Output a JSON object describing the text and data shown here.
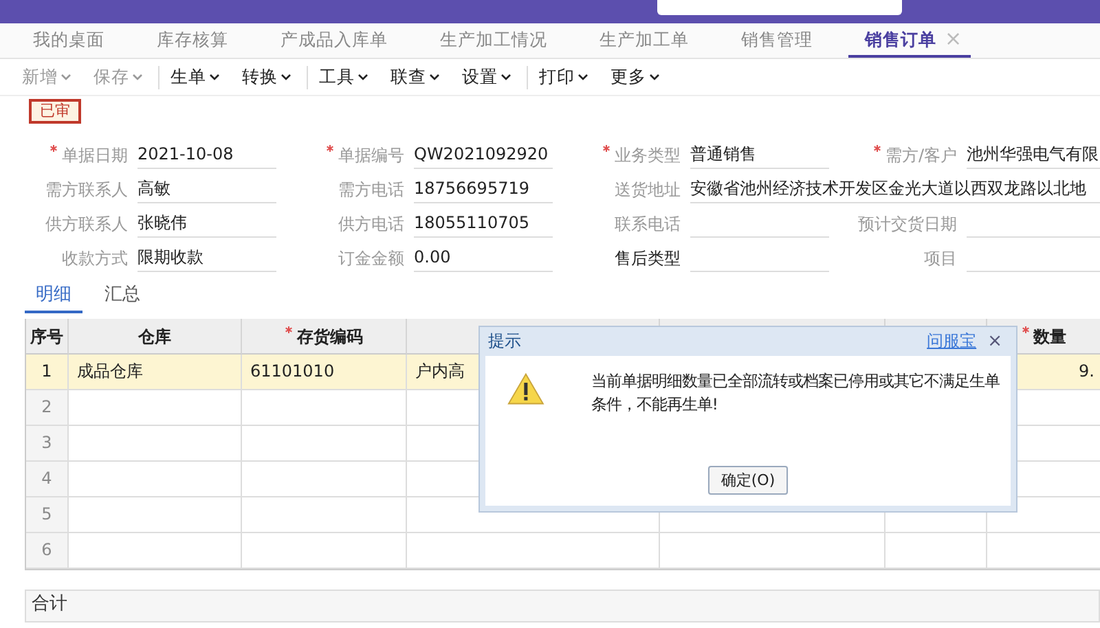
{
  "tabs": [
    {
      "label": "我的桌面",
      "selected": false
    },
    {
      "label": "库存核算",
      "selected": false
    },
    {
      "label": "产成品入库单",
      "selected": false
    },
    {
      "label": "生产加工情况",
      "selected": false
    },
    {
      "label": "生产加工单",
      "selected": false
    },
    {
      "label": "销售管理",
      "selected": false
    },
    {
      "label": "销售订单",
      "selected": true,
      "close": "×"
    }
  ],
  "toolbar": [
    {
      "label": "新增",
      "disabled": true,
      "divider_before": false
    },
    {
      "label": "保存",
      "disabled": true,
      "divider_before": false
    },
    {
      "label": "生单",
      "disabled": false,
      "divider_before": true
    },
    {
      "label": "转换",
      "disabled": false,
      "divider_before": false
    },
    {
      "label": "工具",
      "disabled": false,
      "divider_before": true
    },
    {
      "label": "联查",
      "disabled": false,
      "divider_before": false
    },
    {
      "label": "设置",
      "disabled": false,
      "divider_before": false
    },
    {
      "label": "打印",
      "disabled": false,
      "divider_before": true
    },
    {
      "label": "更多",
      "disabled": false,
      "divider_before": false
    }
  ],
  "status_stamp": "已审",
  "form": {
    "rows": [
      [
        {
          "label": "单据日期",
          "value": "2021-10-08",
          "required": true,
          "dark": false,
          "wide": false
        },
        {
          "label": "单据编号",
          "value": "QW2021092920",
          "required": true,
          "dark": false,
          "wide": false
        },
        {
          "label": "业务类型",
          "value": "普通销售",
          "required": true,
          "dark": false,
          "wide": false
        },
        {
          "label": "需方/客户",
          "value": "池州华强电气有限",
          "required": true,
          "dark": false,
          "wide": false
        }
      ],
      [
        {
          "label": "需方联系人",
          "value": "高敏",
          "required": false,
          "dark": false,
          "wide": false
        },
        {
          "label": "需方电话",
          "value": "18756695719",
          "required": false,
          "dark": false,
          "wide": false
        },
        {
          "label": "送货地址",
          "value": "安徽省池州经济技术开发区金光大道以西双龙路以北地",
          "required": false,
          "dark": false,
          "wide": true
        }
      ],
      [
        {
          "label": "供方联系人",
          "value": "张晓伟",
          "required": false,
          "dark": false,
          "wide": false
        },
        {
          "label": "供方电话",
          "value": "18055110705",
          "required": false,
          "dark": false,
          "wide": false
        },
        {
          "label": "联系电话",
          "required": false,
          "dark": false,
          "wide": false
        },
        {
          "label": "预计交货日期",
          "required": false,
          "dark": false,
          "wide": false
        }
      ],
      [
        {
          "label": "收款方式",
          "value": "限期收款",
          "required": false,
          "dark": false,
          "wide": false
        },
        {
          "label": "订金金额",
          "value": "0.00",
          "required": false,
          "dark": false,
          "wide": false
        },
        {
          "label": "售后类型",
          "required": false,
          "dark": true,
          "wide": false
        },
        {
          "label": "项目",
          "required": false,
          "dark": false,
          "wide": false
        }
      ]
    ]
  },
  "detail_tabs": [
    {
      "label": "明细",
      "selected": true
    },
    {
      "label": "汇总",
      "selected": false
    }
  ],
  "table": {
    "columns": {
      "column_1": {
        "label": "序号",
        "required": false
      },
      "column_2": {
        "label": "仓库",
        "required": false
      },
      "column_3": {
        "label": "存货编码",
        "required": true
      },
      "column_7": {
        "label": "数量",
        "required": true
      }
    },
    "rows": [
      {
        "selected": true,
        "cells": {
          "column_1": "1",
          "column_2": "成品仓库",
          "column_3": "61101010",
          "column_4": "户内高",
          "column_7": "9."
        }
      },
      {
        "selected": false,
        "cells": {
          "column_1": "2"
        }
      },
      {
        "selected": false,
        "cells": {
          "column_1": "3"
        }
      },
      {
        "selected": false,
        "cells": {
          "column_1": "4"
        }
      },
      {
        "selected": false,
        "cells": {
          "column_1": "5"
        }
      },
      {
        "selected": false,
        "cells": {
          "column_1": "6"
        }
      }
    ]
  },
  "total_row": {
    "label": "合计"
  },
  "dialog": {
    "title": "提示",
    "help_link": "问服宝",
    "close": "×",
    "message": "当前单据明细数量已全部流转或档案已停用或其它不满足生单条件，不能再生单!",
    "ok_button": "确定(O)"
  }
}
